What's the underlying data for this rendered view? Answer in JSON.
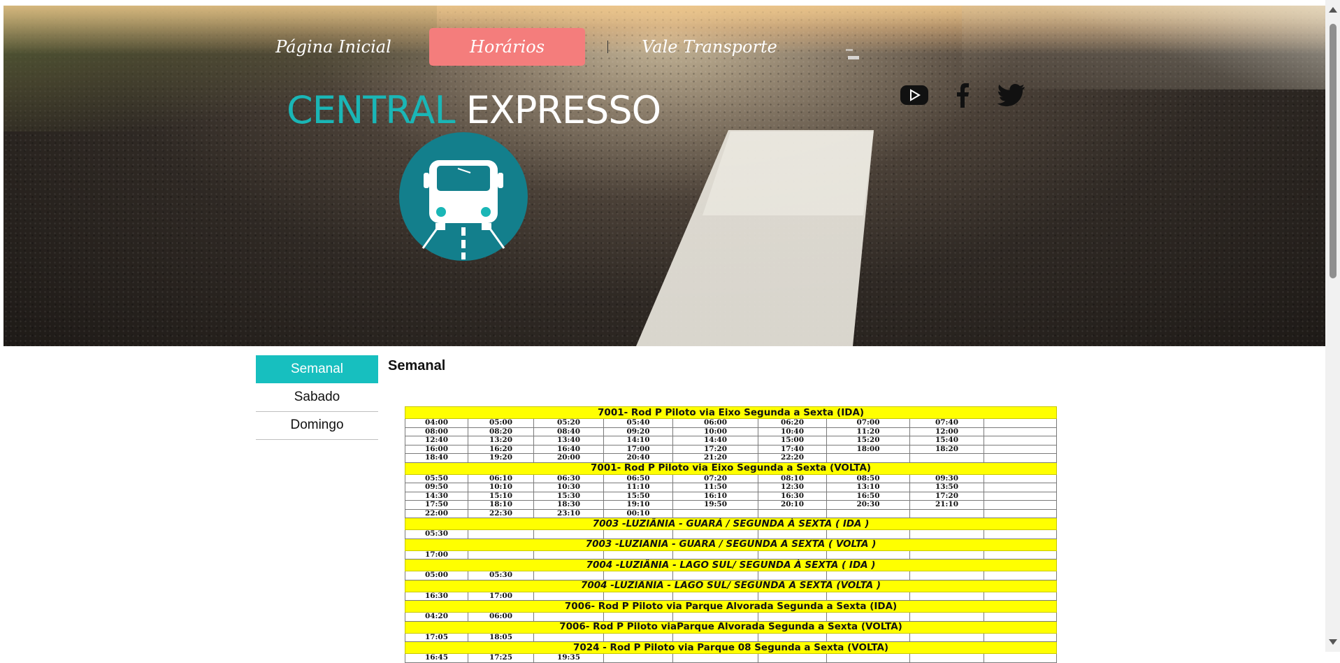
{
  "nav": {
    "home": "Página Inicial",
    "horarios": "Horários",
    "vale": "Vale Transporte"
  },
  "brand": {
    "part1": "CENTRAL",
    "part2": "EXPRESSO"
  },
  "social": [
    "youtube-icon",
    "facebook-icon",
    "twitter-icon"
  ],
  "colors": {
    "teal": "#17bfbf",
    "coral": "#f47d7c",
    "yellow": "#ffff00",
    "logo_circle": "#137f8c"
  },
  "tabs": [
    "Semanal",
    "Sabado",
    "Domingo"
  ],
  "section_title": "Semanal",
  "timetable": [
    {
      "title": "7001- Rod P Piloto via Eixo  Segunda a Sexta  (IDA)",
      "italic": false,
      "rows": [
        [
          "04:00",
          "05:00",
          "05:20",
          "05:40",
          "06:00",
          "06:20",
          "07:00",
          "07:40"
        ],
        [
          "08:00",
          "08:20",
          "08:40",
          "09:20",
          "10:00",
          "10:40",
          "11:20",
          "12:00"
        ],
        [
          "12:40",
          "13:20",
          "13:40",
          "14:10",
          "14:40",
          "15:00",
          "15:20",
          "15:40"
        ],
        [
          "16:00",
          "16:20",
          "16:40",
          "17:00",
          "17:20",
          "17:40",
          "18:00",
          "18:20"
        ],
        [
          "18:40",
          "19:20",
          "20:00",
          "20:40",
          "21:20",
          "22:20"
        ]
      ]
    },
    {
      "title": "7001- Rod P Piloto via Eixo  Segunda a Sexta  (VOLTA)",
      "italic": false,
      "rows": [
        [
          "05:50",
          "06:10",
          "06:30",
          "06:50",
          "07:20",
          "08:10",
          "08:50",
          "09:30"
        ],
        [
          "09:50",
          "10:10",
          "10:30",
          "11:10",
          "11:50",
          "12:30",
          "13:10",
          "13:50"
        ],
        [
          "14:30",
          "15:10",
          "15:30",
          "15:50",
          "16:10",
          "16:30",
          "16:50",
          "17:20"
        ],
        [
          "17:50",
          "18:10",
          "18:30",
          "19:10",
          "19:50",
          "20:10",
          "20:30",
          "21:10"
        ],
        [
          "22:00",
          "22:30",
          "23:10",
          "00:10"
        ]
      ]
    },
    {
      "title": "7003 -LUZIÂNIA - GUARÁ / SEGUNDA À SEXTA ( IDA )",
      "italic": true,
      "rows": [
        [
          "05:30"
        ]
      ]
    },
    {
      "title": "7003 -LUZIÂNIA - GUARÁ / SEGUNDA À SEXTA ( VOLTA )",
      "italic": true,
      "rows": [
        [
          "17:00"
        ]
      ]
    },
    {
      "title": "7004 -LUZIÂNIA - LAGO SUL/ SEGUNDA À SEXTA ( IDA )",
      "italic": true,
      "rows": [
        [
          "05:00",
          "05:30"
        ]
      ]
    },
    {
      "title": "7004 -LUZIÂNIA - LAGO SUL/ SEGUNDA À SEXTA (VOLTA )",
      "italic": true,
      "rows": [
        [
          "16:30",
          "17:00"
        ]
      ]
    },
    {
      "title": "7006- Rod P Piloto via Parque Alvorada  Segunda a Sexta  (IDA)",
      "italic": false,
      "rows": [
        [
          "04:20",
          "06:00"
        ]
      ]
    },
    {
      "title": "7006- Rod P Piloto viaParque Alvorada  Segunda a Sexta  (VOLTA)",
      "italic": false,
      "rows": [
        [
          "17:05",
          "18:05"
        ]
      ]
    },
    {
      "title": "7024 - Rod P Piloto via Parque 08  Segunda a Sexta  (VOLTA)",
      "italic": false,
      "rows": [
        [
          "16:45",
          "17:25",
          "19:35"
        ]
      ]
    }
  ]
}
